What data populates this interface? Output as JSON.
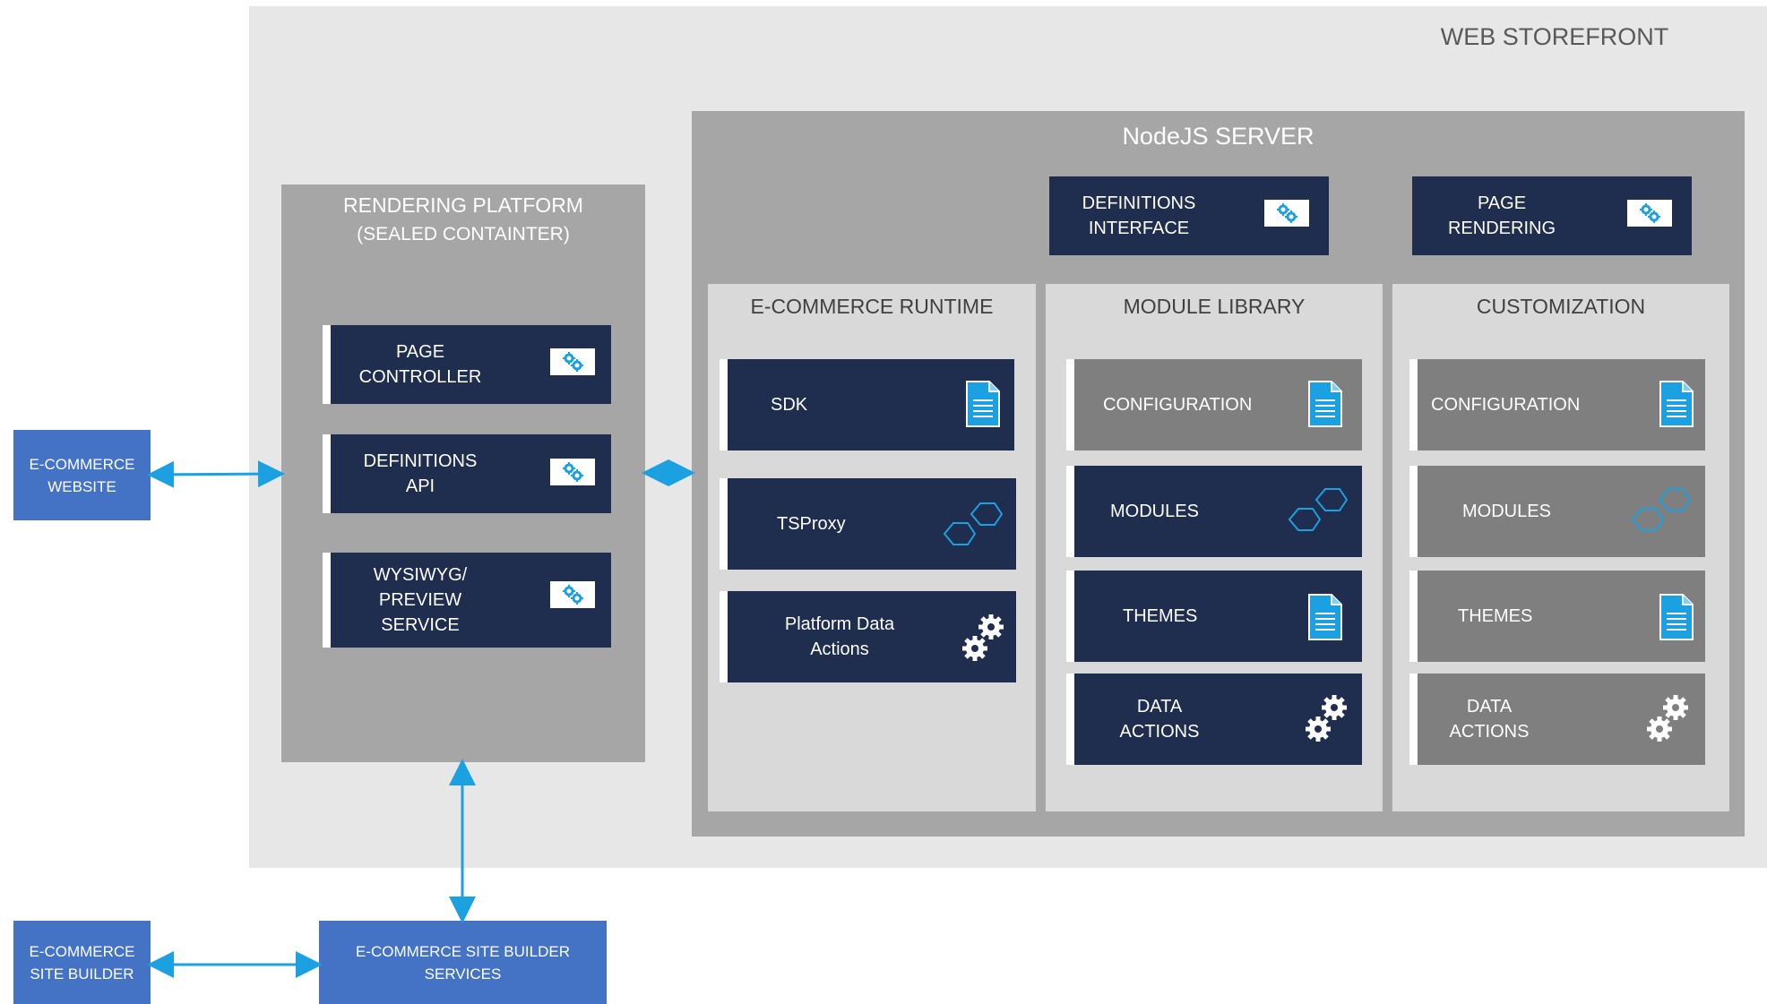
{
  "web_storefront": {
    "title": "WEB STOREFRONT"
  },
  "rendering_platform": {
    "title": "RENDERING PLATFORM",
    "subtitle": "(SEALED CONTAINTER)",
    "items": [
      {
        "label": "PAGE\nCONTROLLER",
        "icon": "gears-badge-icon"
      },
      {
        "label": "DEFINITIONS\nAPI",
        "icon": "gears-badge-icon"
      },
      {
        "label": "WYSIWYG/\nPREVIEW\nSERVICE",
        "icon": "gears-badge-icon"
      }
    ]
  },
  "nodejs_server": {
    "title": "NodeJS SERVER",
    "top_items": [
      {
        "label": "DEFINITIONS\nINTERFACE",
        "icon": "gears-badge-icon"
      },
      {
        "label": "PAGE\nRENDERING",
        "icon": "gears-badge-icon"
      }
    ],
    "columns": [
      {
        "title": "E-COMMERCE RUNTIME",
        "items": [
          {
            "label": "SDK",
            "icon": "document-icon",
            "style": "dark"
          },
          {
            "label": "TSProxy",
            "icon": "hexagons-icon",
            "style": "dark"
          },
          {
            "label": "Platform Data\nActions",
            "icon": "gears-icon",
            "style": "dark"
          }
        ]
      },
      {
        "title": "MODULE LIBRARY",
        "items": [
          {
            "label": "CONFIGURATION",
            "icon": "document-icon",
            "style": "gray"
          },
          {
            "label": "MODULES",
            "icon": "hexagons-icon",
            "style": "dark"
          },
          {
            "label": "THEMES",
            "icon": "document-icon",
            "style": "dark"
          },
          {
            "label": "DATA\nACTIONS",
            "icon": "gears-icon",
            "style": "dark"
          }
        ]
      },
      {
        "title": "CUSTOMIZATION",
        "items": [
          {
            "label": "CONFIGURATION",
            "icon": "document-icon",
            "style": "gray"
          },
          {
            "label": "MODULES",
            "icon": "hexagons-icon",
            "style": "gray"
          },
          {
            "label": "THEMES",
            "icon": "document-icon",
            "style": "gray"
          },
          {
            "label": "DATA\nACTIONS",
            "icon": "gears-icon",
            "style": "gray"
          }
        ]
      }
    ]
  },
  "external": {
    "website": "E-COMMERCE\nWEBSITE",
    "site_builder": "E-COMMERCE\nSITE BUILDER",
    "site_builder_services": "E-COMMERCE SITE BUILDER\nSERVICES"
  },
  "colors": {
    "dark_card": "#1f2d4e",
    "gray_card": "#7f7f7f",
    "accent": "#1ba1e2",
    "blue_box": "#4472c4"
  }
}
